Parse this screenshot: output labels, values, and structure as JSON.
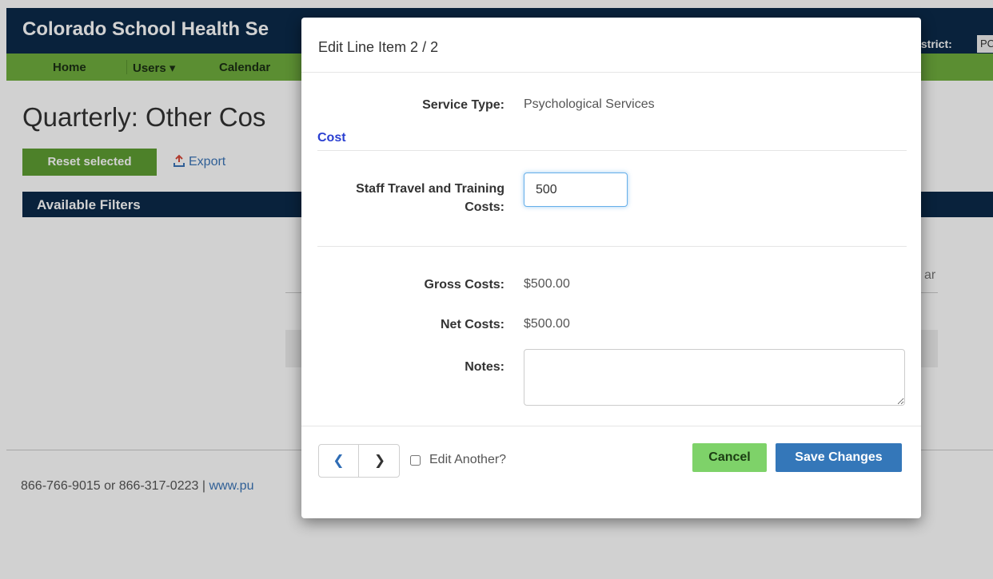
{
  "app": {
    "brand": "Colorado School Health Se",
    "district_label": "istrict:",
    "district_value": "PC"
  },
  "nav": {
    "items": [
      "Home",
      "Users ▾",
      "Calendar"
    ]
  },
  "page": {
    "title": "Quarterly: Other Cos",
    "reset_label": "Reset selected",
    "export_label": "Export",
    "filters_label": "Available Filters",
    "bg_fragment": "ar"
  },
  "footer": {
    "phones": "866-766-9015 or 866-317-0223 | ",
    "link": "www.pu"
  },
  "modal": {
    "title": "Edit Line Item 2 / 2",
    "service_type_label": "Service Type:",
    "service_type_value": "Psychological Services",
    "section_cost": "Cost",
    "staff_travel_label": "Staff Travel and Training Costs:",
    "staff_travel_value": "500",
    "gross_costs_label": "Gross Costs:",
    "gross_costs_value": "$500.00",
    "net_costs_label": "Net Costs:",
    "net_costs_value": "$500.00",
    "notes_label": "Notes:",
    "notes_value": "",
    "edit_another_label": "Edit Another?",
    "cancel_label": "Cancel",
    "save_label": "Save Changes"
  },
  "colors": {
    "header_navy": "#0b2a4a",
    "nav_green": "#6fae3e",
    "cancel_green": "#7ed269",
    "save_blue": "#3477b9",
    "cost_blue": "#2a3fd1"
  },
  "icons": {
    "export": "export-icon",
    "prev": "chevron-left-icon",
    "next": "chevron-right-icon"
  }
}
